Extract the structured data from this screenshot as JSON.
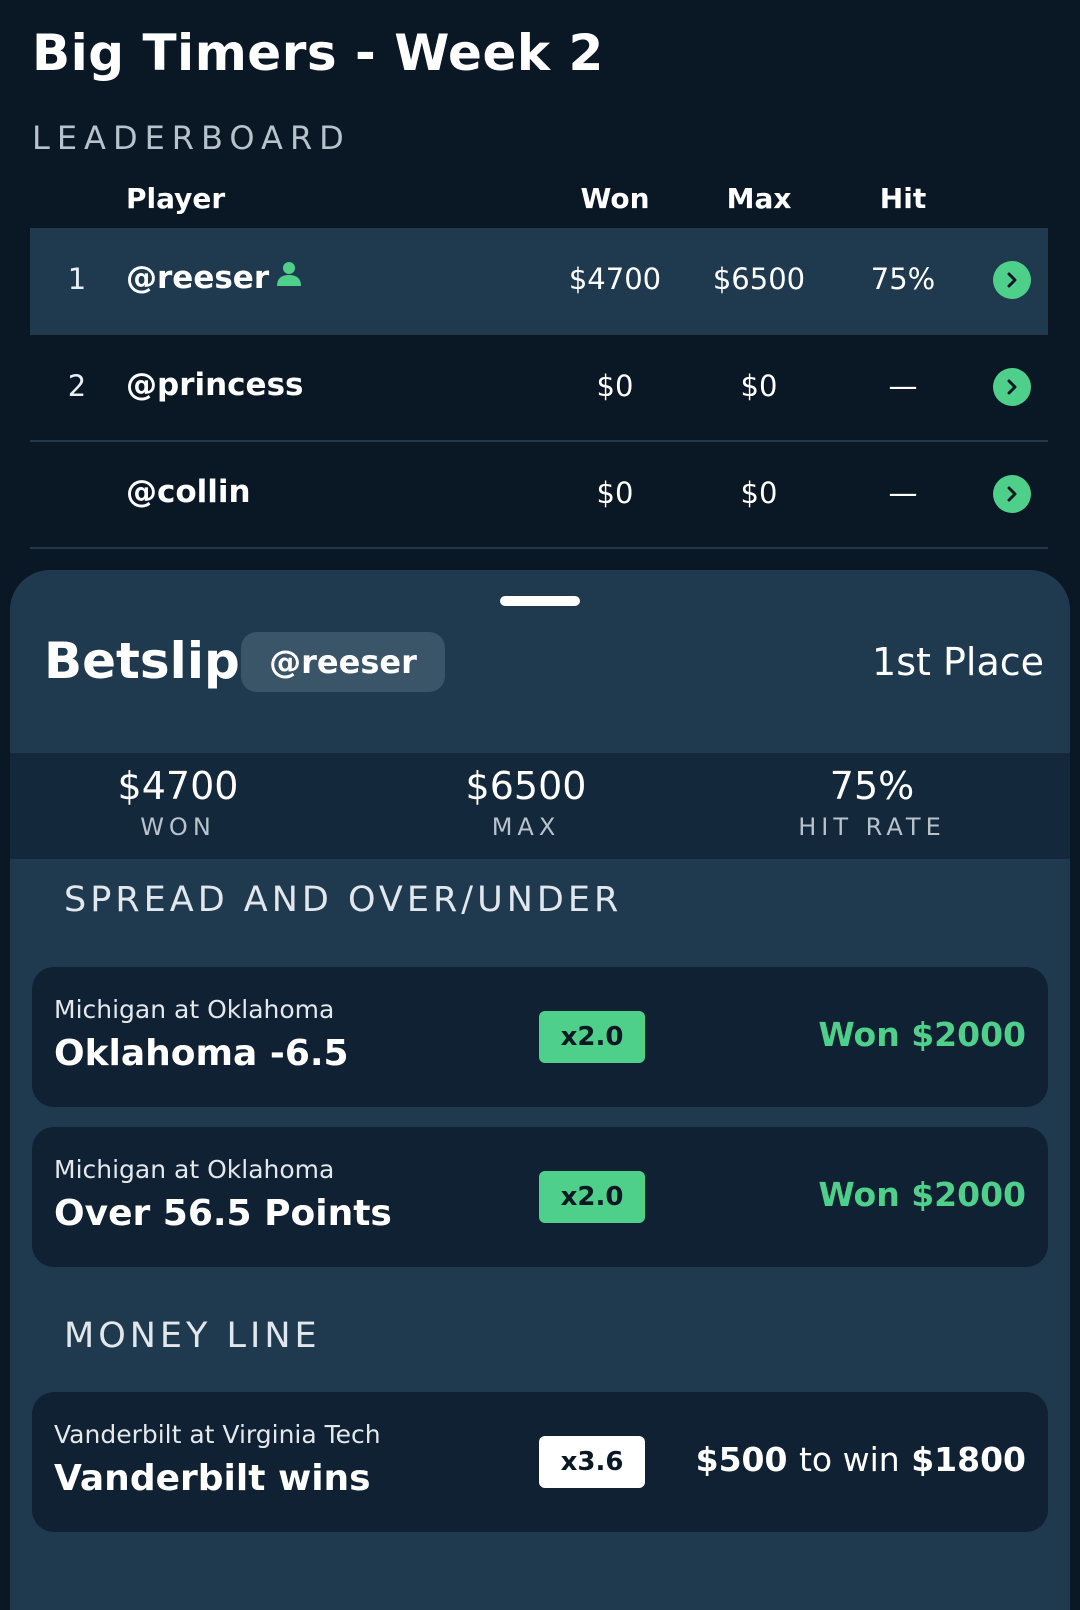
{
  "header": {
    "title": "Big Timers - Week 2",
    "subtitle": "LEADERBOARD"
  },
  "leaderboard": {
    "columns": {
      "player": "Player",
      "won": "Won",
      "max": "Max",
      "hit": "Hit"
    },
    "rows": [
      {
        "rank": "1",
        "handle": "@reeser",
        "won": "$4700",
        "max": "$6500",
        "hit": "75%",
        "is_current_user": true
      },
      {
        "rank": "2",
        "handle": "@princess",
        "won": "$0",
        "max": "$0",
        "hit": "—"
      },
      {
        "rank": "",
        "handle": "@collin",
        "won": "$0",
        "max": "$0",
        "hit": "—"
      }
    ]
  },
  "betslip": {
    "title": "Betslip",
    "user": "@reeser",
    "place": "1st Place",
    "stats": {
      "won": {
        "value": "$4700",
        "label": "WON"
      },
      "max": {
        "value": "$6500",
        "label": "MAX"
      },
      "hit_rate": {
        "value": "75%",
        "label": "HIT RATE"
      }
    },
    "sections": [
      {
        "title": "SPREAD AND OVER/UNDER",
        "bets": [
          {
            "game": "Michigan at Oklahoma",
            "pick": "Oklahoma -6.5",
            "multiplier": "x2.0",
            "result": "Won $2000"
          },
          {
            "game": "Michigan at Oklahoma",
            "pick": "Over 56.5 Points",
            "multiplier": "x2.0",
            "result": "Won $2000"
          }
        ]
      },
      {
        "title": "MONEY LINE",
        "bets": [
          {
            "game": "Vanderbilt at Virginia Tech",
            "pick": "Vanderbilt wins",
            "multiplier": "x3.6",
            "stake": "$500",
            "to_win_label": "to win",
            "payout": "$1800"
          }
        ]
      }
    ]
  },
  "colors": {
    "background": "#0a1724",
    "sheet": "#1f3a4f",
    "card": "#102133",
    "accent_green": "#4fd08a"
  }
}
